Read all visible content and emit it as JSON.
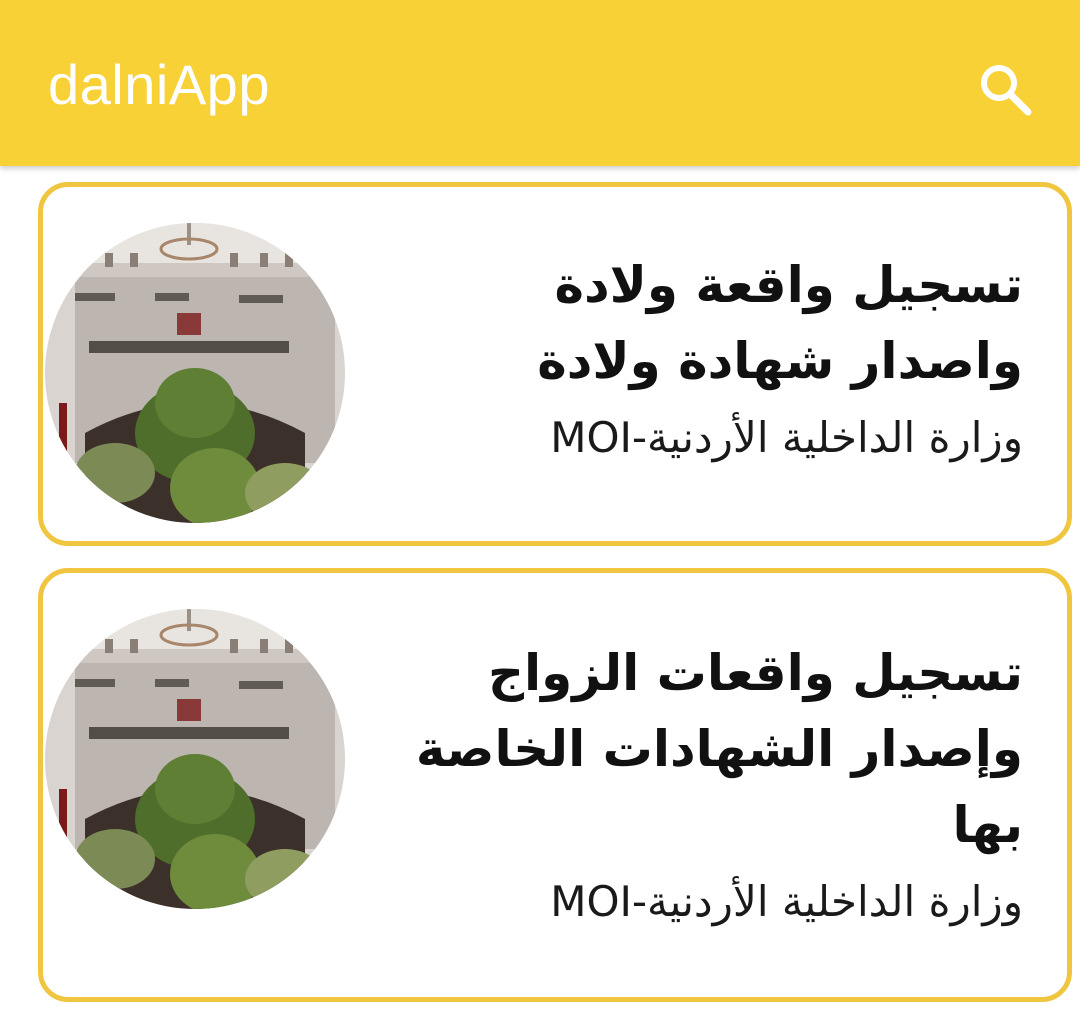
{
  "app_bar": {
    "title": "dalniApp",
    "search_icon": "search-icon",
    "background_color": "#f7d135",
    "title_color": "#ffffff"
  },
  "services": [
    {
      "title": "تسجيل واقعة ولادة واصدار شهادة ولادة",
      "subtitle": "وزارة الداخلية الأردنية-MOI",
      "thumbnail_icon": "ministry-building-thumbnail"
    },
    {
      "title": "تسجيل واقعات الزواج وإصدار الشهادات الخاصة بها",
      "subtitle": "وزارة الداخلية الأردنية-MOI",
      "thumbnail_icon": "ministry-building-thumbnail"
    }
  ],
  "colors": {
    "card_border": "#f0c640",
    "text": "#111111"
  }
}
